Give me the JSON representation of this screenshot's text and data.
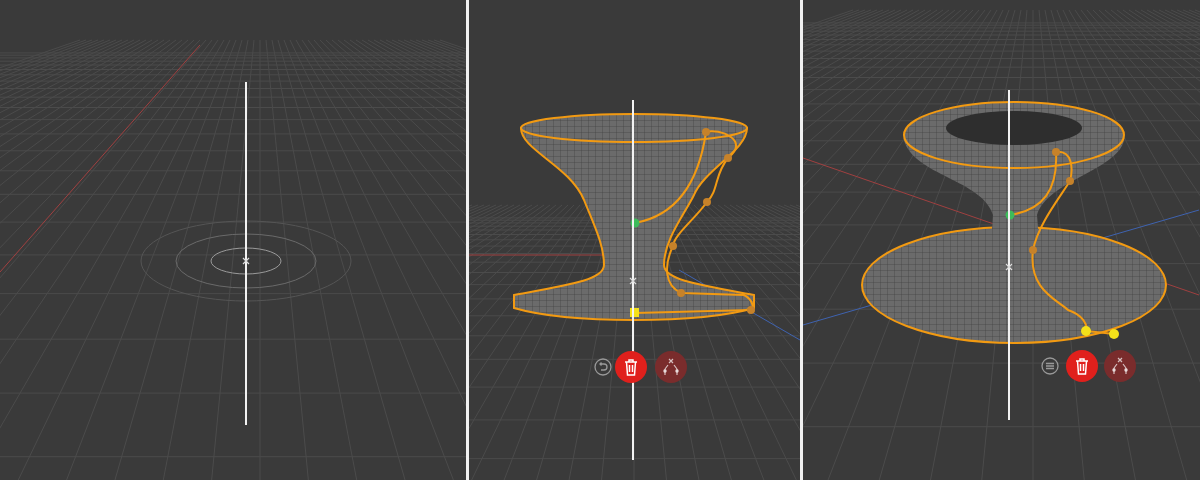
{
  "viewports": [
    {
      "kind": "empty"
    },
    {
      "kind": "vase",
      "toolbar": [
        {
          "kind": "undo",
          "disabled": false
        },
        {
          "kind": "delete",
          "disabled": false
        },
        {
          "kind": "split",
          "disabled": true
        }
      ]
    },
    {
      "kind": "cup",
      "toolbar": [
        {
          "kind": "menu",
          "disabled": false
        },
        {
          "kind": "delete",
          "disabled": false
        },
        {
          "kind": "split",
          "disabled": true
        }
      ]
    }
  ]
}
